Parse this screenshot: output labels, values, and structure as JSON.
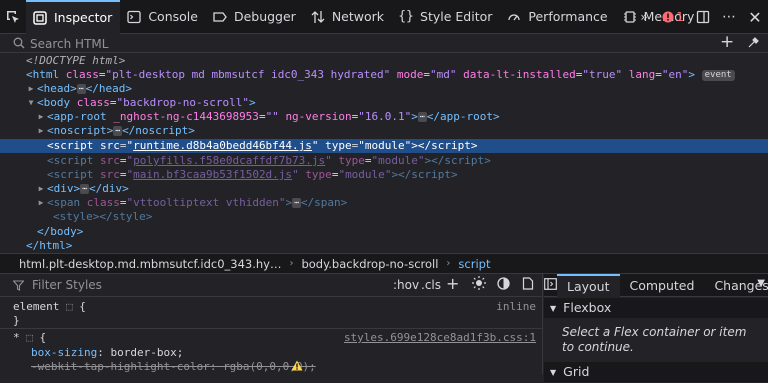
{
  "toolbar": {
    "tabs": [
      {
        "label": "Inspector",
        "icon": "inspector-icon",
        "active": true
      },
      {
        "label": "Console",
        "icon": "console-icon"
      },
      {
        "label": "Debugger",
        "icon": "debugger-icon"
      },
      {
        "label": "Network",
        "icon": "network-icon"
      },
      {
        "label": "Style Editor",
        "icon": "style-editor-icon"
      },
      {
        "label": "Performance",
        "icon": "performance-icon"
      },
      {
        "label": "Memory",
        "icon": "memory-icon"
      }
    ],
    "error_count": "1"
  },
  "search": {
    "placeholder": "Search HTML"
  },
  "markup": {
    "doctype": "<!DOCTYPE html>",
    "html_open": {
      "tag": "html",
      "class": "plt-desktop md mbmsutcf idc0_343 hydrated",
      "mode": "md",
      "data_lt_installed": "true",
      "lang": "en",
      "badge": "event"
    },
    "head": "head",
    "body": {
      "tag": "body",
      "class": "backdrop-no-scroll"
    },
    "app_root": {
      "tag": "app-root",
      "attr": "_nghost-ng-c1443698953",
      "ng_version": "16.0.1"
    },
    "noscript": "noscript",
    "scripts": [
      {
        "src": "runtime.d8b4a0bedd46bf44.js",
        "type": "module"
      },
      {
        "src": "polyfills.f58e0dcaffdf7b73.js",
        "type": "module"
      },
      {
        "src": "main.bf3caa9b53f1502d.js",
        "type": "module"
      }
    ],
    "div": "div",
    "span_class": "vttooltiptext vthidden",
    "style": "style",
    "close_body": "</body>",
    "close_html": "</html>"
  },
  "breadcrumbs": [
    "html.plt-desktop.md.mbmsutcf.idc0_343.hy…",
    "body.backdrop-no-scroll",
    "script"
  ],
  "rules": {
    "filter_placeholder": "Filter Styles",
    "hov": ":hov",
    "cls": ".cls",
    "element_selector": "element",
    "inline_label": "inline",
    "universal_selector": "*",
    "source": "styles.699e128ce8ad1f3b.css:1",
    "decl1_prop": "box-sizing",
    "decl1_val": "border-box;",
    "decl2_prop": "-webkit-tap-highlight-color",
    "decl2_val": "rgba(0,0,0,0);"
  },
  "layout": {
    "tabs": [
      "Layout",
      "Computed",
      "Changes"
    ],
    "flexbox": "Flexbox",
    "flex_hint": "Select a Flex container or item to continue.",
    "grid": "Grid"
  }
}
